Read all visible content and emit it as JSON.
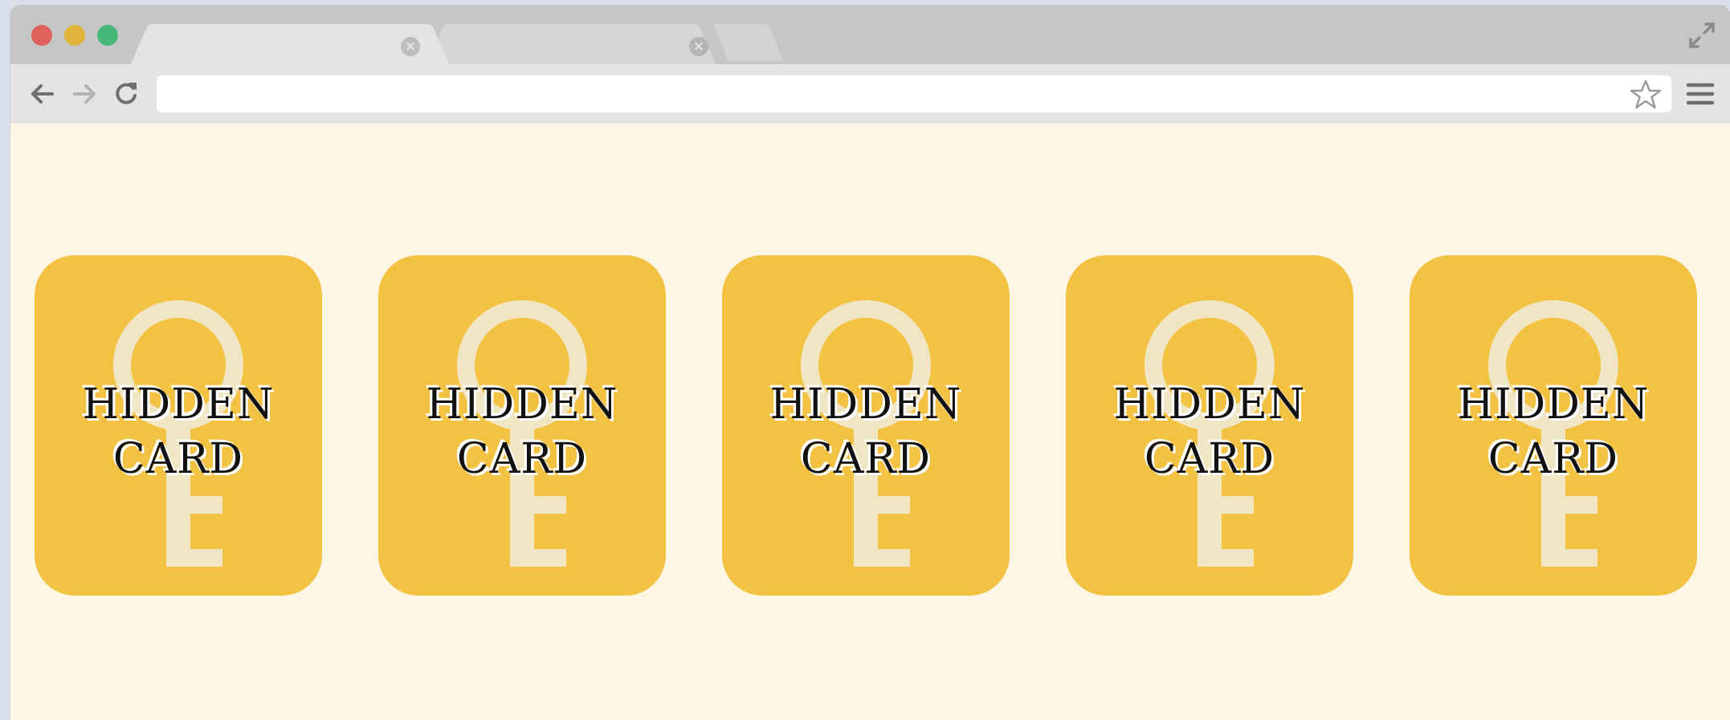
{
  "browser": {
    "tabs": [
      {
        "label": "",
        "close_symbol": "×"
      },
      {
        "label": "",
        "close_symbol": "×"
      },
      {
        "label": ""
      }
    ],
    "icons": {
      "back": "back-arrow-icon",
      "forward": "forward-arrow-icon",
      "reload": "reload-icon",
      "bookmark": "star-icon",
      "menu": "hamburger-menu-icon",
      "fullscreen": "expand-icon"
    },
    "address_bar": {
      "value": "",
      "placeholder": ""
    }
  },
  "colors": {
    "page_background": "#fdf6e5",
    "card_background": "#f3c242",
    "key_watermark": "#f0e6c4",
    "traffic_red": "#e0605c",
    "traffic_yellow": "#e1b53d",
    "traffic_green": "#46b97a"
  },
  "cards": [
    {
      "line1": "HIDDEN",
      "line2": "CARD",
      "icon": "key-icon"
    },
    {
      "line1": "HIDDEN",
      "line2": "CARD",
      "icon": "key-icon"
    },
    {
      "line1": "HIDDEN",
      "line2": "CARD",
      "icon": "key-icon"
    },
    {
      "line1": "HIDDEN",
      "line2": "CARD",
      "icon": "key-icon"
    },
    {
      "line1": "HIDDEN",
      "line2": "CARD",
      "icon": "key-icon"
    }
  ]
}
